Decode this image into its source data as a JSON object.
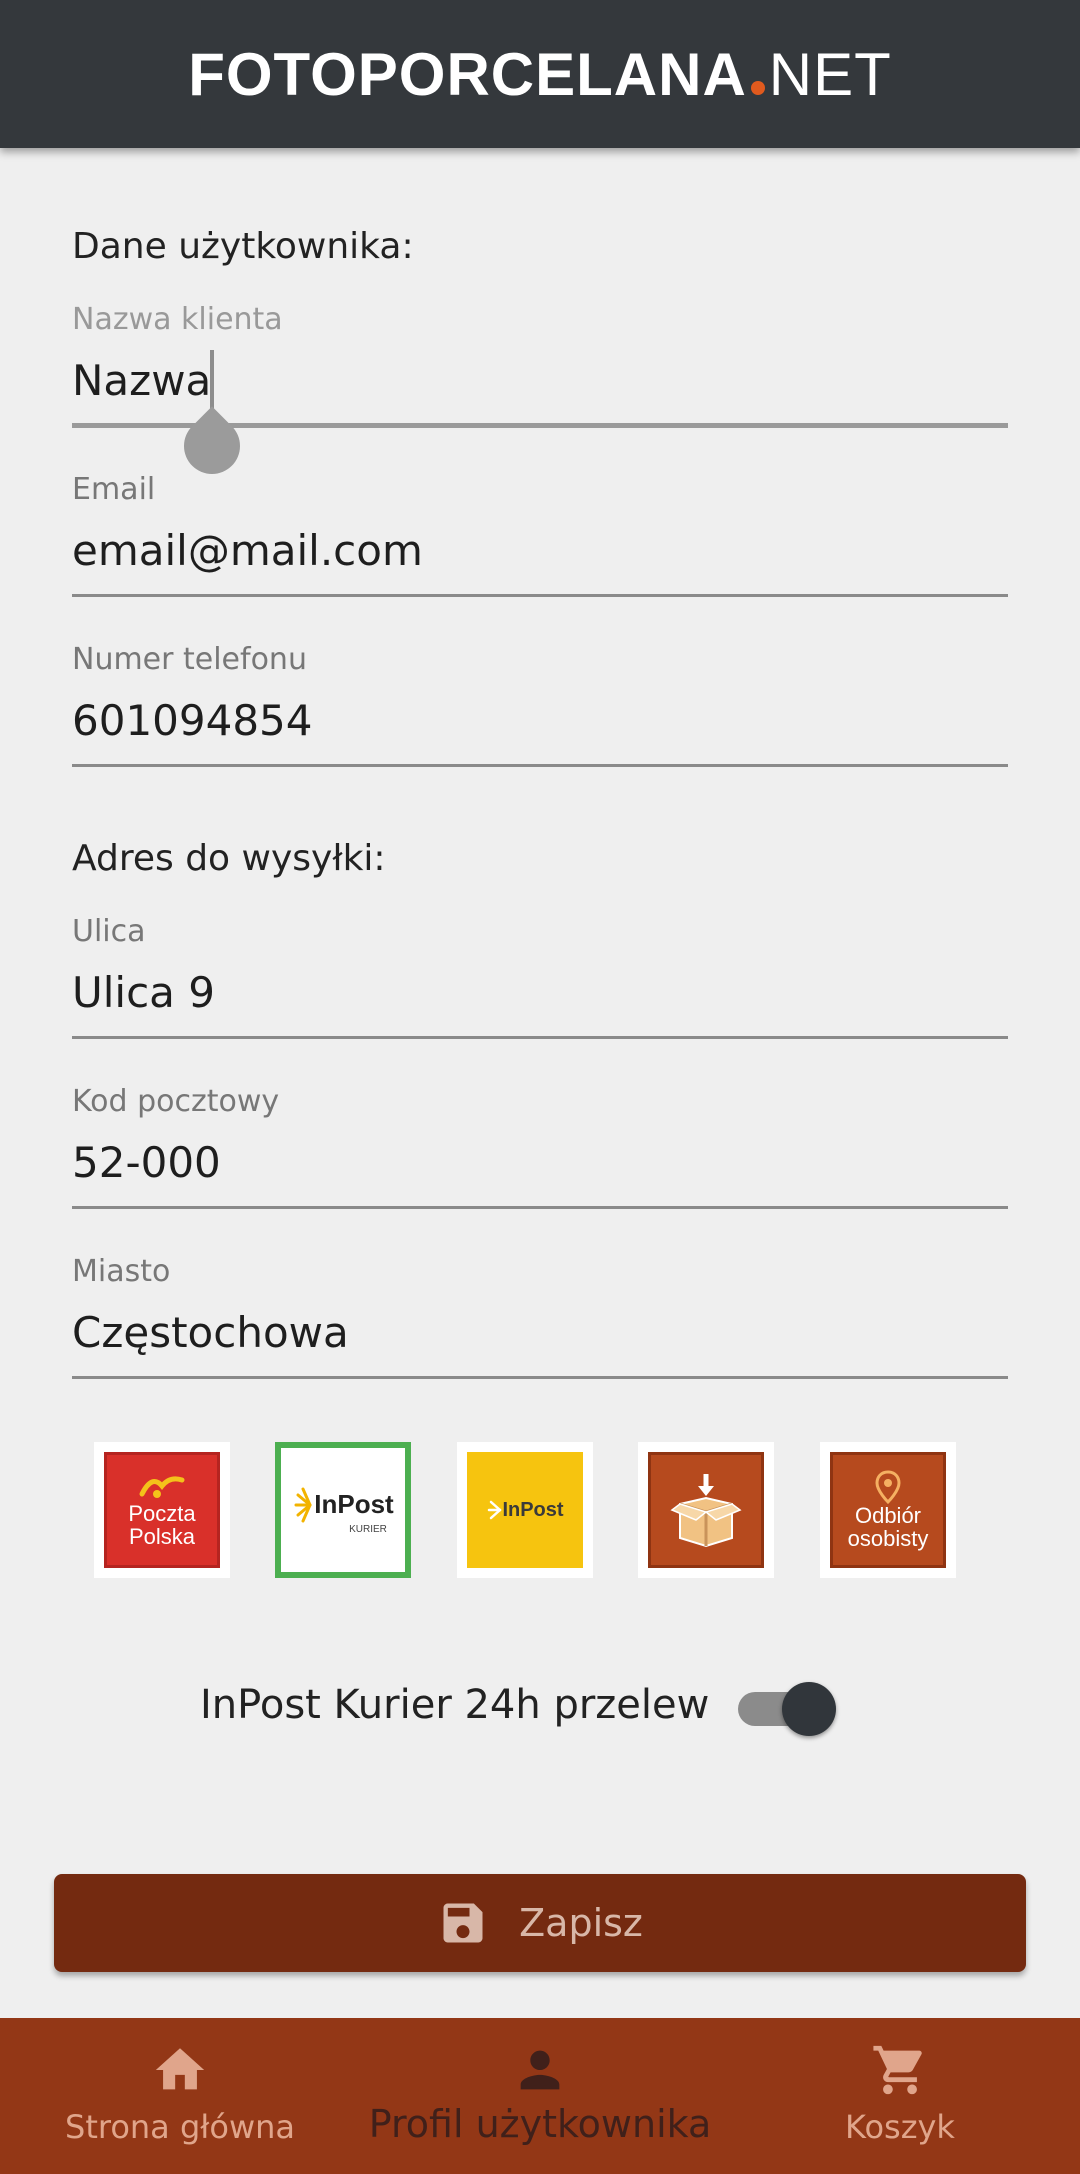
{
  "header": {
    "logo_main": "FOTOPORCELANA",
    "logo_tld": "NET"
  },
  "user_section": {
    "title": "Dane użytkownika:",
    "client_name": {
      "label": "Nazwa klienta",
      "value": "Nazwa"
    },
    "email": {
      "label": "Email",
      "value": "email@mail.com"
    },
    "phone": {
      "label": "Numer telefonu",
      "value": "601094854"
    }
  },
  "shipping_section": {
    "title": "Adres do wysyłki:",
    "street": {
      "label": "Ulica",
      "value": "Ulica 9"
    },
    "postal_code": {
      "label": "Kod pocztowy",
      "value": "52-000"
    },
    "city": {
      "label": "Miasto",
      "value": "Częstochowa"
    }
  },
  "carriers": [
    {
      "name": "Poczta Polska",
      "line1": "Poczta",
      "line2": "Polska",
      "selected": false
    },
    {
      "name": "InPost Kurier",
      "text": "InPost",
      "sub": "KURIER",
      "selected": true
    },
    {
      "name": "InPost Paczkomaty",
      "text": "InPost",
      "selected": false
    },
    {
      "name": "Paczka",
      "selected": false
    },
    {
      "name": "Odbiór osobisty",
      "line1": "Odbiór",
      "line2": "osobisty",
      "selected": false
    }
  ],
  "shipping_option": {
    "label": "InPost Kurier 24h przelew",
    "enabled": true
  },
  "save_button": {
    "label": "Zapisz"
  },
  "bottom_nav": {
    "home": "Strona główna",
    "profile": "Profil użytkownika",
    "cart": "Koszyk",
    "active": "profile"
  },
  "colors": {
    "header_bg": "#34383c",
    "logo_accent": "#e05a1e",
    "save_button_bg": "#742a10",
    "nav_bg": "#933716",
    "selected_border": "#4caf50"
  }
}
